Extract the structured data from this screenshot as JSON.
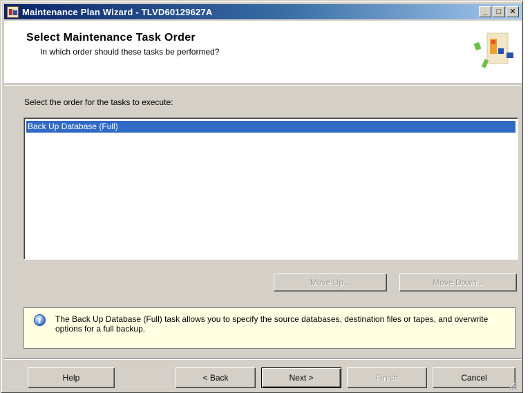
{
  "window": {
    "title": "Maintenance Plan Wizard - TLVD60129627A",
    "minimize_glyph": "_",
    "maximize_glyph": "□",
    "close_glyph": "✕"
  },
  "header": {
    "title": "Select Maintenance Task Order",
    "subtitle": "In which order should these tasks be performed?"
  },
  "main": {
    "list_label": "Select the order for the tasks to execute:",
    "tasks": [
      {
        "label": "Back Up Database (Full)",
        "selected": true
      }
    ],
    "move_up_label": "Move Up...",
    "move_down_label": "Move Down..."
  },
  "info": {
    "text": "The Back Up Database (Full) task allows you to specify the source databases, destination files or tapes, and overwrite options for a full backup."
  },
  "footer": {
    "help_label": "Help",
    "back_label": "< Back",
    "next_label": "Next >",
    "finish_label": "Finish",
    "cancel_label": "Cancel"
  },
  "colors": {
    "selection": "#316ac5",
    "dialog_face": "#d4d0c8",
    "info_background": "#ffffe1"
  }
}
